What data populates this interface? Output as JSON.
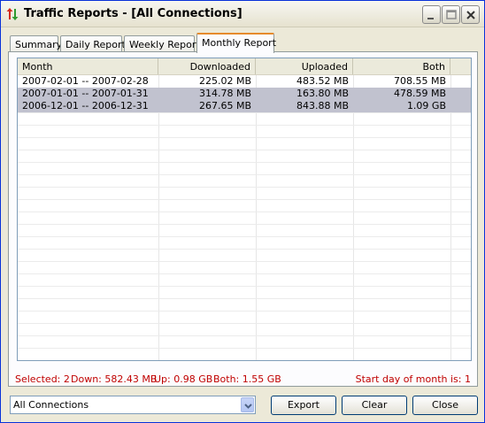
{
  "window": {
    "title": "Traffic Reports - [All Connections]"
  },
  "tabs": [
    {
      "label": "Summary",
      "active": false
    },
    {
      "label": "Daily Report",
      "active": false
    },
    {
      "label": "Weekly Report",
      "active": false
    },
    {
      "label": "Monthly Report",
      "active": true
    }
  ],
  "table": {
    "columns": [
      "Month",
      "Downloaded",
      "Uploaded",
      "Both"
    ],
    "rows": [
      {
        "month": "2007-02-01 -- 2007-02-28",
        "downloaded": "225.02 MB",
        "uploaded": "483.52 MB",
        "both": "708.55 MB",
        "selected": false
      },
      {
        "month": "2007-01-01 -- 2007-01-31",
        "downloaded": "314.78 MB",
        "uploaded": "163.80 MB",
        "both": "478.59 MB",
        "selected": true
      },
      {
        "month": "2006-12-01 -- 2006-12-31",
        "downloaded": "267.65 MB",
        "uploaded": "843.88 MB",
        "both": "1.09 GB",
        "selected": true
      }
    ]
  },
  "status": {
    "selected": "Selected: 2",
    "down": "Down: 582.43 MB",
    "up": "Up: 0.98 GB",
    "both": "Both: 1.55 GB",
    "start_day": "Start day of month is: 1"
  },
  "bottom": {
    "connection_select": "All Connections",
    "export_label": "Export",
    "clear_label": "Clear",
    "close_label": "Close"
  },
  "colors": {
    "status_text": "#c00000",
    "selected_row": "#c1c2cf",
    "active_tab_accent": "#e68b2c"
  }
}
